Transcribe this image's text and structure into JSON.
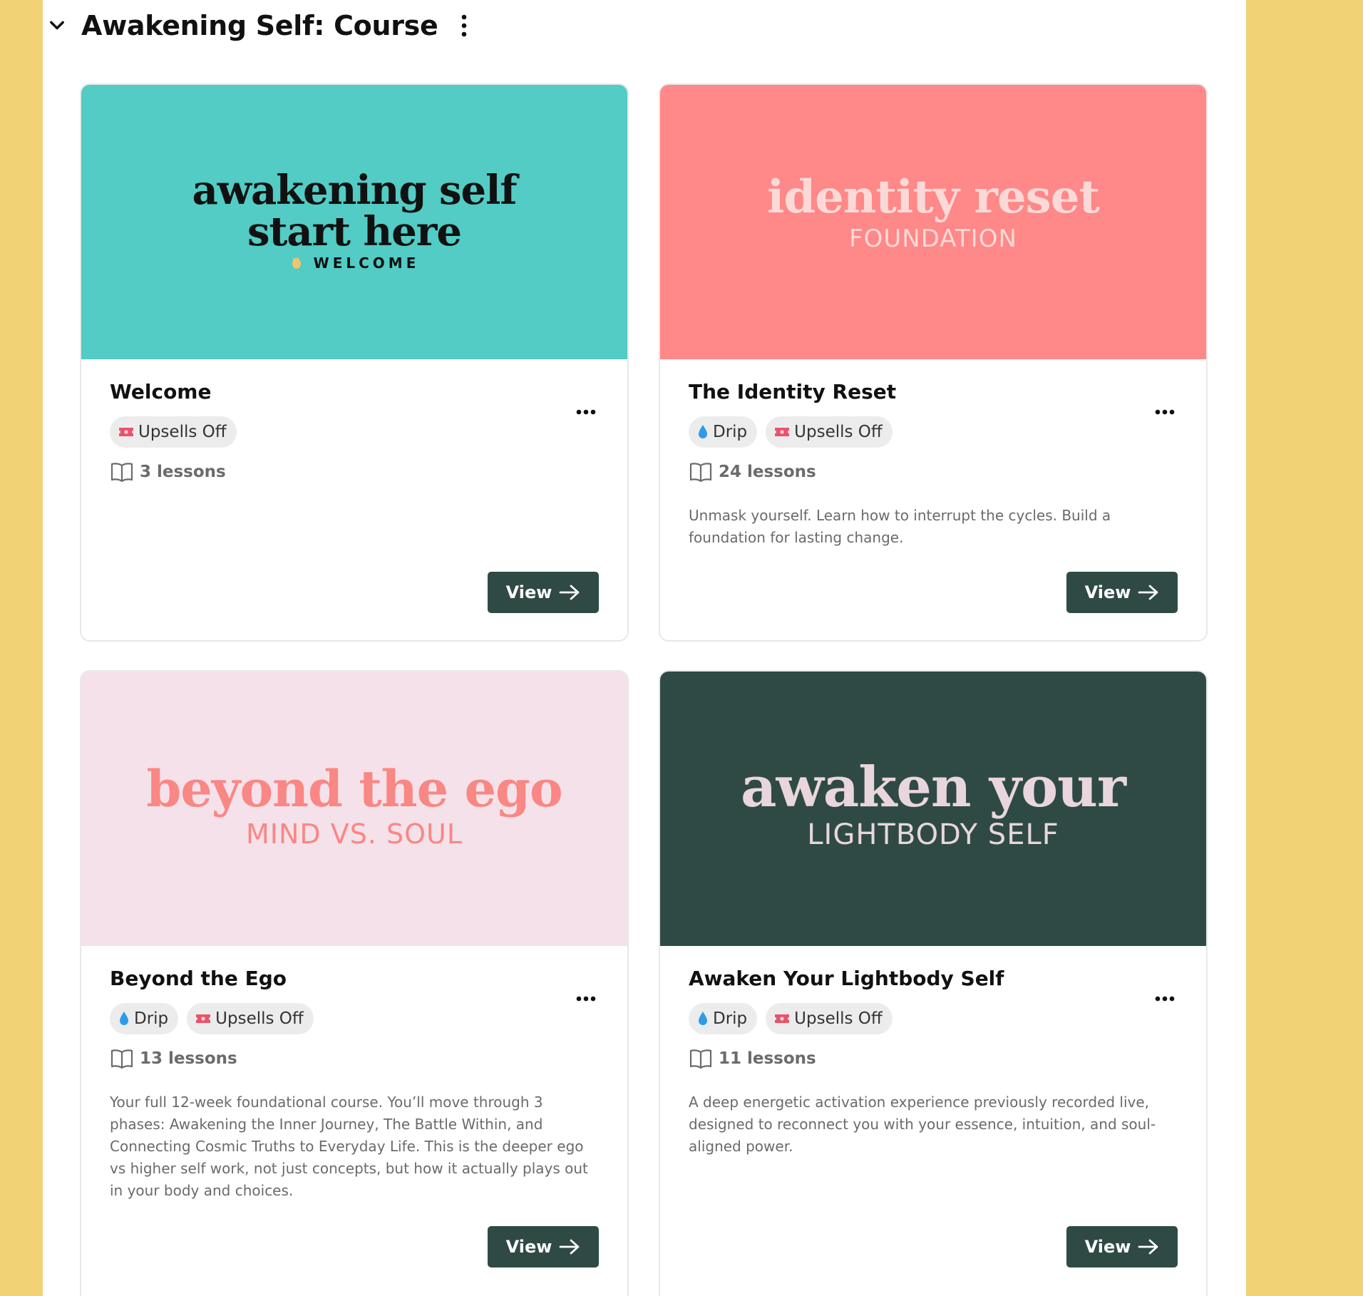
{
  "section": {
    "title": "Awakening Self: Course"
  },
  "colors": {
    "page_bg": "#f1d275",
    "button_bg": "#2f4a44",
    "teal": "#52ccc4",
    "coral": "#ff8888",
    "pink": "#f4e1ea",
    "forest": "#2f4a44"
  },
  "cards": [
    {
      "thumb": {
        "line1": "awakening self",
        "line2": "start here",
        "line3": "WELCOME"
      },
      "title": "Welcome",
      "tags": [
        "Upsells Off"
      ],
      "lessons": "3 lessons",
      "description": "",
      "button": "View"
    },
    {
      "thumb": {
        "line1": "identity reset",
        "line2": "FOUNDATION"
      },
      "title": "The Identity Reset",
      "tags": [
        "Drip",
        "Upsells Off"
      ],
      "lessons": "24 lessons",
      "description": "Unmask yourself. Learn how to interrupt the cycles. Build a foundation for lasting change.",
      "button": "View"
    },
    {
      "thumb": {
        "line1": "beyond the ego",
        "line2": "MIND VS. SOUL"
      },
      "title": "Beyond the Ego",
      "tags": [
        "Drip",
        "Upsells Off"
      ],
      "lessons": "13 lessons",
      "description": "Your full 12-week foundational course. You’ll move through 3 phases: Awakening the Inner Journey, The Battle Within, and Connecting Cosmic Truths to Everyday Life. This is the deeper ego vs higher self work, not just concepts, but how it actually plays out in your body and choices.",
      "button": "View"
    },
    {
      "thumb": {
        "line1": "awaken your",
        "line2": "LIGHTBODY SELF"
      },
      "title": "Awaken Your Lightbody Self",
      "tags": [
        "Drip",
        "Upsells Off"
      ],
      "lessons": "11 lessons",
      "description": "A deep energetic activation experience previously recorded live, designed to reconnect you with your essence, intuition, and soul-aligned power.",
      "button": "View"
    }
  ],
  "icons": {
    "collapse": "chevron-down-icon",
    "section_menu": "vertical-dots-icon",
    "card_menu": "horizontal-dots-icon",
    "drip": "water-drop-icon",
    "upsells": "ticket-icon",
    "lessons": "book-icon",
    "view": "arrow-right-icon",
    "welcome": "wave-hand-icon"
  }
}
